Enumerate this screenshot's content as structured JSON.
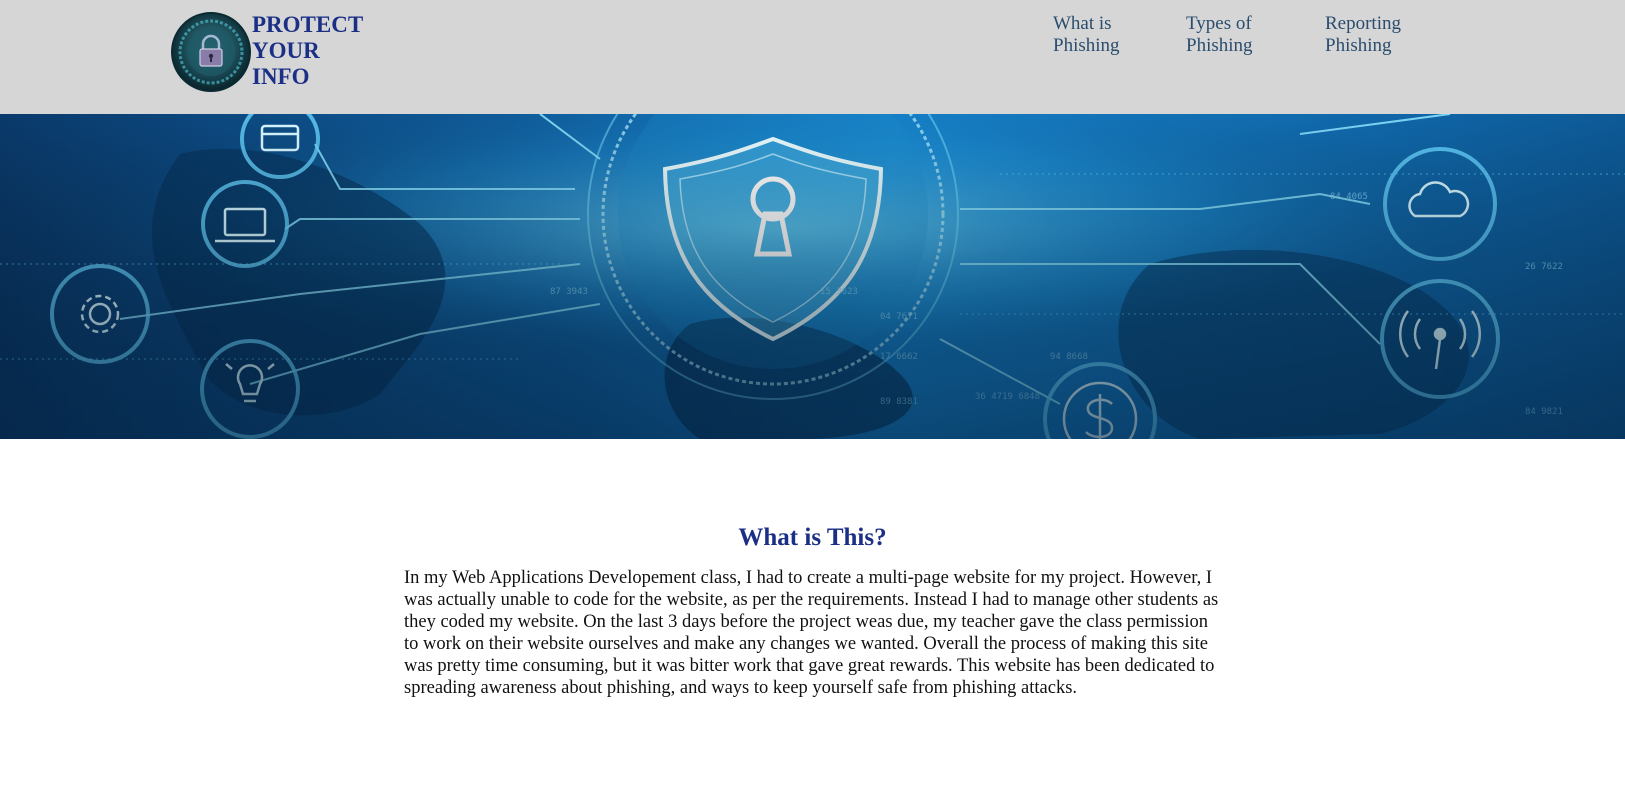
{
  "header": {
    "logo_text": "PROTECT\nYOUR\nINFO",
    "logo_icon": "padlock-globe-icon",
    "background": "#d6d6d6",
    "brand_color": "#1b2f86"
  },
  "nav": {
    "items": [
      {
        "label": "What is\nPhishing"
      },
      {
        "label": "Types of\nPhishing"
      },
      {
        "label": "Reporting\nPhishing"
      }
    ],
    "color": "#2a4d6e"
  },
  "banner": {
    "image": "cybersecurity-shield-network-banner",
    "icons": [
      "shield-keyhole-icon",
      "credit-card-icon",
      "laptop-icon",
      "gear-icon",
      "lightbulb-icon",
      "cloud-icon",
      "wifi-signal-icon",
      "dollar-icon"
    ]
  },
  "main": {
    "title": "What is This?",
    "body": "In my Web Applications Developement class, I had to create a multi-page website for my project. However, I was actually unable to code for the website, as per the requirements. Instead I had to manage other students as they coded my website. On the last 3 days before the project weas due, my teacher gave the class permission to work on their website ourselves and make any changes we wanted. Overall the process of making this site was pretty time consuming, but it was bitter work that gave great rewards. This website has been dedicated to spreading awareness about phishing, and ways to keep yourself safe from phishing attacks."
  }
}
